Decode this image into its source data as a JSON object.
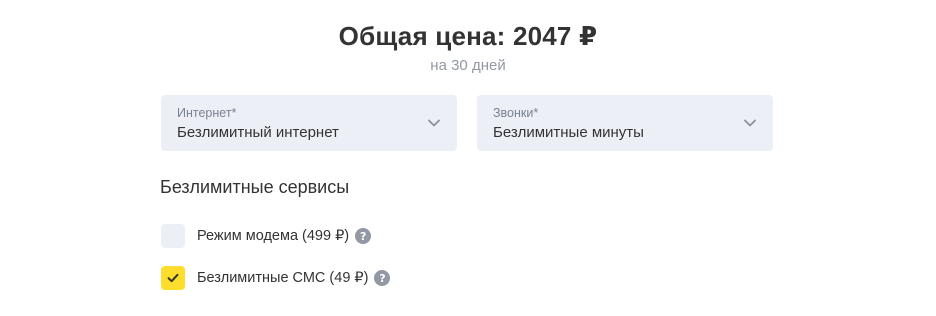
{
  "price": {
    "title": "Общая цена: 2047 ₽",
    "period": "на 30 дней"
  },
  "selects": {
    "internet": {
      "label": "Интернет*",
      "value": "Безлимитный интернет",
      "icon": "chevron-down-icon"
    },
    "calls": {
      "label": "Звонки*",
      "value": "Безлимитные минуты",
      "icon": "chevron-down-icon"
    }
  },
  "services": {
    "title": "Безлимитные сервисы",
    "items": [
      {
        "label": "Режим модема (499 ₽)",
        "checked": false,
        "icon": "help-icon"
      },
      {
        "label": "Безлимитные СМС (49 ₽)",
        "checked": true,
        "icon": "help-icon"
      }
    ]
  },
  "colors": {
    "accent": "#ffdd2d",
    "field_bg": "#ecf0f6",
    "text": "#333333",
    "muted": "#9299a2"
  },
  "help_glyph": "?"
}
